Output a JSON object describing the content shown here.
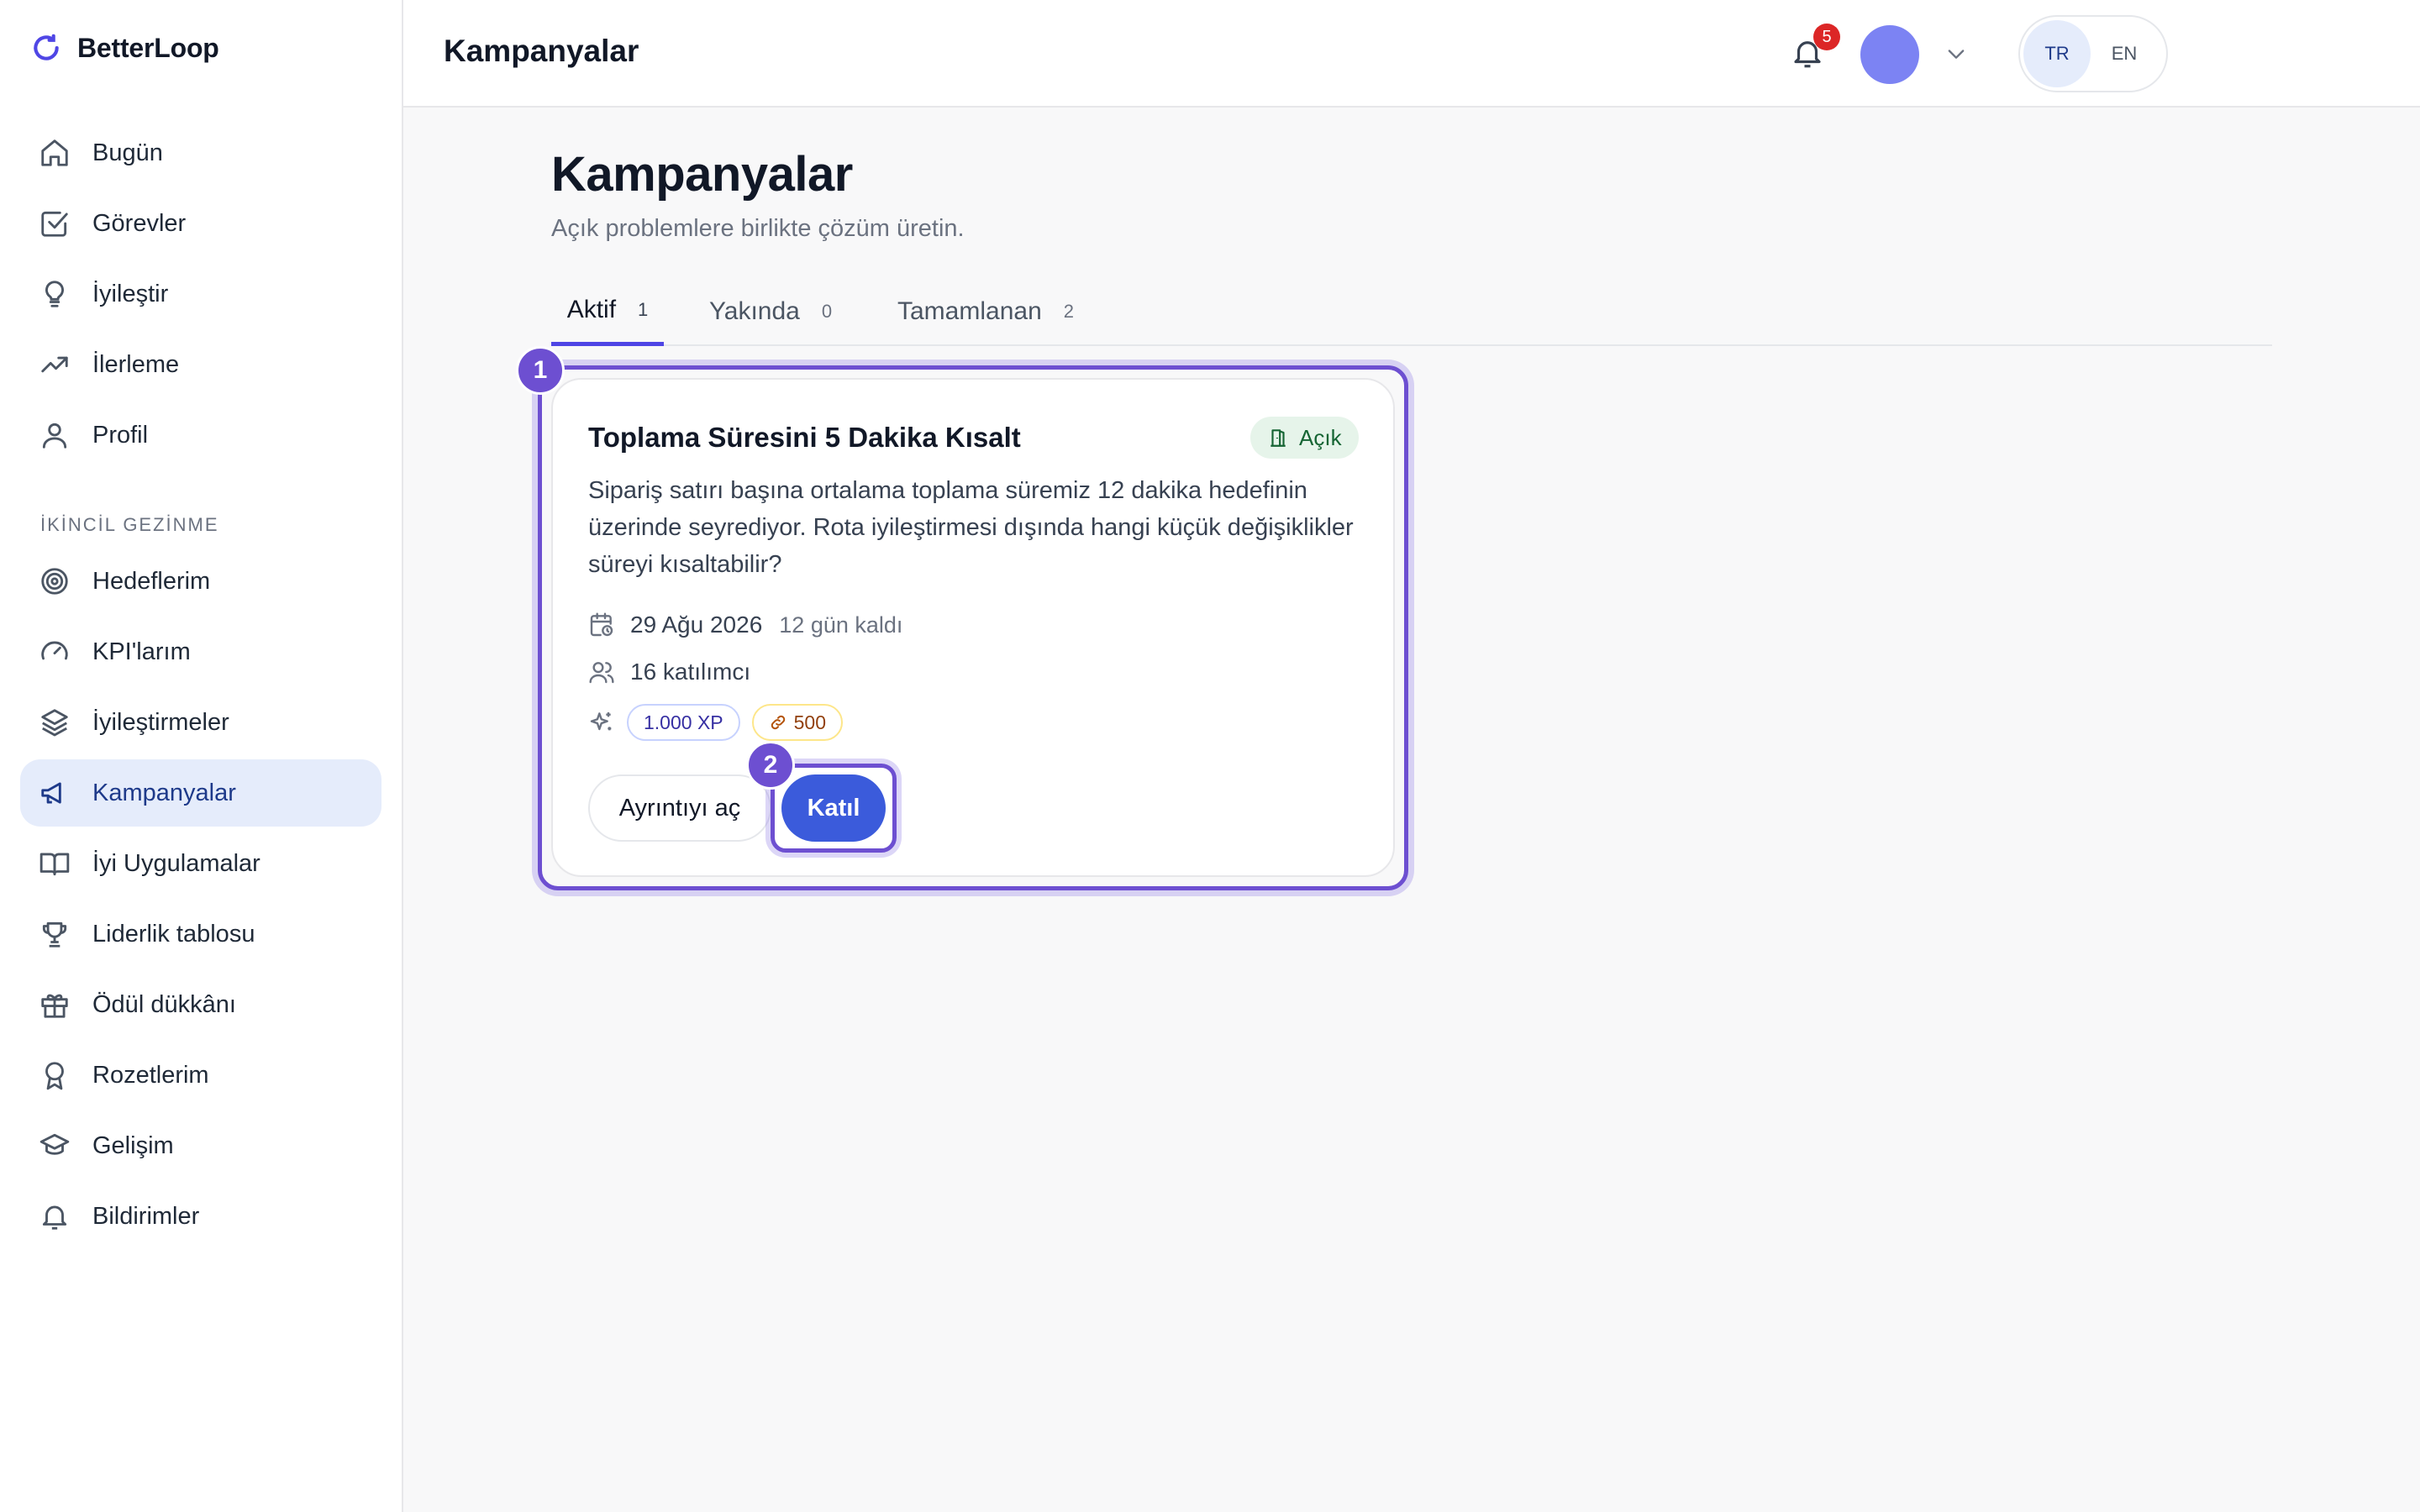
{
  "app": {
    "name": "BetterLoop",
    "logo_icon": "refresh-loop-icon",
    "accent_color": "#4f46e5",
    "primary_button_color": "#3b5bdb",
    "highlight_color": "#6d4fd1"
  },
  "sidebar": {
    "primary_items": [
      {
        "label": "Bugün",
        "icon": "home-icon"
      },
      {
        "label": "Görevler",
        "icon": "check-square-icon"
      },
      {
        "label": "İyileştir",
        "icon": "lightbulb-icon"
      },
      {
        "label": "İlerleme",
        "icon": "trending-up-icon"
      },
      {
        "label": "Profil",
        "icon": "user-icon"
      }
    ],
    "section_label": "İKİNCİL GEZİNME",
    "secondary_items": [
      {
        "label": "Hedeflerim",
        "icon": "target-icon"
      },
      {
        "label": "KPI'larım",
        "icon": "gauge-icon"
      },
      {
        "label": "İyileştirmeler",
        "icon": "layers-icon"
      },
      {
        "label": "Kampanyalar",
        "icon": "megaphone-icon",
        "active": true
      },
      {
        "label": "İyi Uygulamalar",
        "icon": "book-open-icon"
      },
      {
        "label": "Liderlik tablosu",
        "icon": "trophy-icon"
      },
      {
        "label": "Ödül dükkânı",
        "icon": "gift-icon"
      },
      {
        "label": "Rozetlerim",
        "icon": "award-icon"
      },
      {
        "label": "Gelişim",
        "icon": "graduation-cap-icon"
      },
      {
        "label": "Bildirimler",
        "icon": "bell-icon"
      }
    ]
  },
  "topbar": {
    "title": "Kampanyalar",
    "languages": [
      {
        "code": "TR",
        "active": true
      },
      {
        "code": "EN",
        "active": false
      }
    ],
    "notification_count": "5"
  },
  "main": {
    "title": "Kampanyalar",
    "subtitle": "Açık problemlere birlikte çözüm üretin.",
    "tabs": [
      {
        "label": "Aktif",
        "count": "1",
        "active": true
      },
      {
        "label": "Yakında",
        "count": "0",
        "active": false
      },
      {
        "label": "Tamamlanan",
        "count": "2",
        "active": false
      }
    ],
    "markers": {
      "card": "1",
      "join": "2"
    },
    "campaign": {
      "title": "Toplama Süresini 5 Dakika Kısalt",
      "status": "Açık",
      "description": "Sipariş satırı başına ortalama toplama süremiz 12 dakika hedefinin üzerinde seyrediyor. Rota iyileştirmesi dışında hangi küçük değişiklikler süreyi kısaltabilir?",
      "date": "29 Ağu 2026",
      "remaining": "12 gün kaldı",
      "participants": "16 katılımcı",
      "xp_reward": "1.000 XP",
      "coin_reward": "500",
      "details_button": "Ayrıntıyı aç",
      "join_button": "Katıl"
    }
  }
}
